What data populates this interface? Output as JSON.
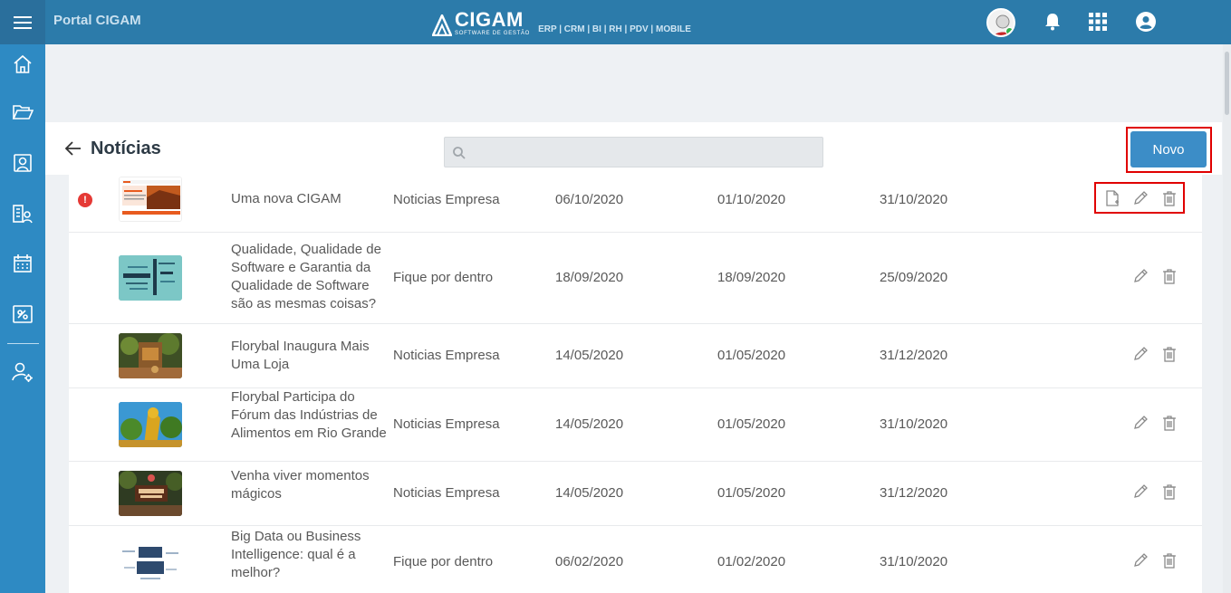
{
  "app": {
    "portal_title": "Portal CIGAM",
    "brand_name": "CIGAM",
    "brand_tagline": "SOFTWARE DE GESTÃO",
    "brand_modules": "ERP | CRM | BI | RH | PDV | MOBILE"
  },
  "colors": {
    "topbar": "#2c7baa",
    "sidebar": "#2e8ac3",
    "primary_button": "#3c8dc7",
    "highlight": "#e00000",
    "alert": "#e53935"
  },
  "topbar_icons": [
    "user-avatar",
    "bell-icon",
    "apps-grid-icon",
    "account-circle-icon"
  ],
  "sidebar": {
    "items": [
      {
        "icon": "home-icon"
      },
      {
        "icon": "folder-open-icon"
      },
      {
        "icon": "contacts-icon"
      },
      {
        "icon": "org-chart-icon"
      },
      {
        "icon": "calendar-icon"
      },
      {
        "icon": "ticket-icon"
      },
      {
        "icon": "user-settings-icon"
      }
    ]
  },
  "page": {
    "title": "Notícias",
    "search_placeholder": "",
    "search_value": "",
    "new_button_label": "Novo"
  },
  "news": [
    {
      "title": "Uma nova CIGAM",
      "category": "Noticias Empresa",
      "date1": "06/10/2020",
      "date2": "01/10/2020",
      "date3": "31/10/2020",
      "alert": true,
      "alert_symbol": "!",
      "has_doc_action": true,
      "thumbnail": "corporate-news-thumbnail"
    },
    {
      "title": "Qualidade, Qualidade de Software e Garantia da Qualidade de Software são as mesmas coisas?",
      "category": "Fique por dentro",
      "date1": "18/09/2020",
      "date2": "18/09/2020",
      "date3": "25/09/2020",
      "alert": false,
      "has_doc_action": false,
      "thumbnail": "word-cloud-thumbnail"
    },
    {
      "title": "Florybal Inaugura Mais Uma Loja",
      "category": "Noticias Empresa",
      "date1": "14/05/2020",
      "date2": "01/05/2020",
      "date3": "31/12/2020",
      "alert": false,
      "has_doc_action": false,
      "thumbnail": "garden-store-thumbnail"
    },
    {
      "title": "Florybal Participa do Fórum das Indústrias de Alimentos em Rio Grande",
      "category": "Noticias Empresa",
      "date1": "14/05/2020",
      "date2": "01/05/2020",
      "date3": "31/10/2020",
      "alert": false,
      "has_doc_action": false,
      "thumbnail": "statue-park-thumbnail"
    },
    {
      "title": "Venha viver momentos mágicos",
      "category": "Noticias Empresa",
      "date1": "14/05/2020",
      "date2": "01/05/2020",
      "date3": "31/12/2020",
      "alert": false,
      "has_doc_action": false,
      "thumbnail": "florybal-park-thumbnail"
    },
    {
      "title": "Big Data ou Business Intelligence: qual é a melhor?",
      "category": "Fique por dentro",
      "date1": "06/02/2020",
      "date2": "01/02/2020",
      "date3": "31/10/2020",
      "alert": false,
      "has_doc_action": false,
      "thumbnail": "big-data-thumbnail"
    }
  ]
}
